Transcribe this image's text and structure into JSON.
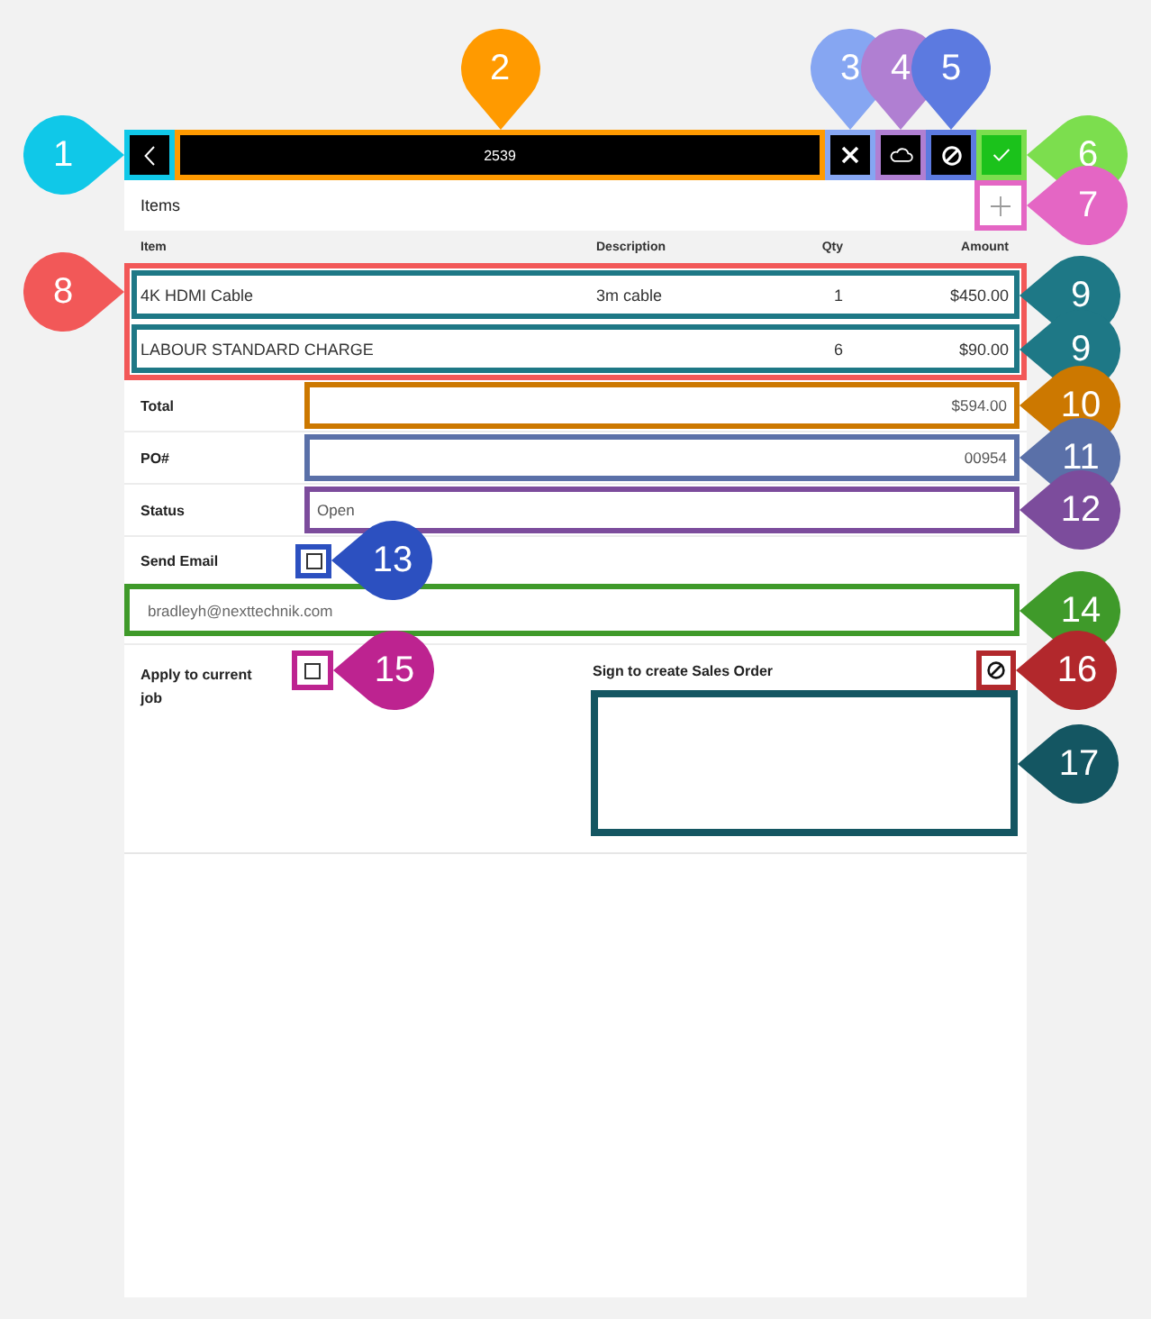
{
  "toolbar": {
    "back_button": {
      "callout": {
        "number": "1",
        "color": "#10c8e8"
      }
    },
    "title": {
      "text": "2539",
      "callout": {
        "number": "2",
        "color": "#ff9a00"
      }
    },
    "actions": [
      {
        "kind": "cancel",
        "callout": {
          "number": "3",
          "color": "#86a6f2"
        }
      },
      {
        "kind": "cloud",
        "callout": {
          "number": "4",
          "color": "#b07fd2"
        }
      },
      {
        "kind": "prohibit",
        "callout": {
          "number": "5",
          "color": "#5c7ae0"
        }
      },
      {
        "kind": "confirm",
        "callout": {
          "number": "6",
          "color": "#7cde4e"
        }
      }
    ]
  },
  "items": {
    "title": "Items",
    "add_button": {
      "callout": {
        "number": "7",
        "color": "#e466c4"
      }
    },
    "columns": [
      "Item",
      "Description",
      "Qty",
      "Amount"
    ],
    "callout": {
      "number": "8",
      "color": "#f25858"
    },
    "rows": [
      {
        "item": "4K HDMI Cable",
        "description": "3m cable",
        "qty": "1",
        "amount": "$450.00",
        "callout": {
          "number": "9",
          "color": "#1e7886"
        }
      },
      {
        "item": "LABOUR STANDARD CHARGE",
        "qty": "6",
        "amount": "$90.00",
        "callout": {
          "number": "9",
          "color": "#1e7886"
        }
      }
    ]
  },
  "form": {
    "fields": [
      {
        "label": "Total",
        "kind": "numeric",
        "value": "$594.00",
        "callout": {
          "number": "10",
          "color": "#cc7800"
        }
      },
      {
        "label": "PO#",
        "kind": "numeric",
        "value": "00954",
        "callout": {
          "number": "11",
          "color": "#5a70a8"
        }
      },
      {
        "label": "Status",
        "kind": "text",
        "value": "Open",
        "callout": {
          "number": "12",
          "color": "#7c4c9c"
        }
      }
    ],
    "send_email": {
      "label": "Send Email",
      "checked": false,
      "callout": {
        "number": "13",
        "color": "#2c50c0"
      }
    },
    "email": {
      "value": "bradleyh@nexttechnik.com",
      "callout": {
        "number": "14",
        "color": "#3f9a2a"
      }
    },
    "apply_to_job": {
      "label": "Apply to current job",
      "checked": false,
      "callout": {
        "number": "15",
        "color": "#bd2390"
      }
    },
    "signature": {
      "label": "Sign to create Sales Order",
      "clear_button": {
        "callout": {
          "number": "16",
          "color": "#b2282c"
        }
      },
      "pad": {
        "callout": {
          "number": "17",
          "color": "#145662"
        }
      }
    }
  }
}
